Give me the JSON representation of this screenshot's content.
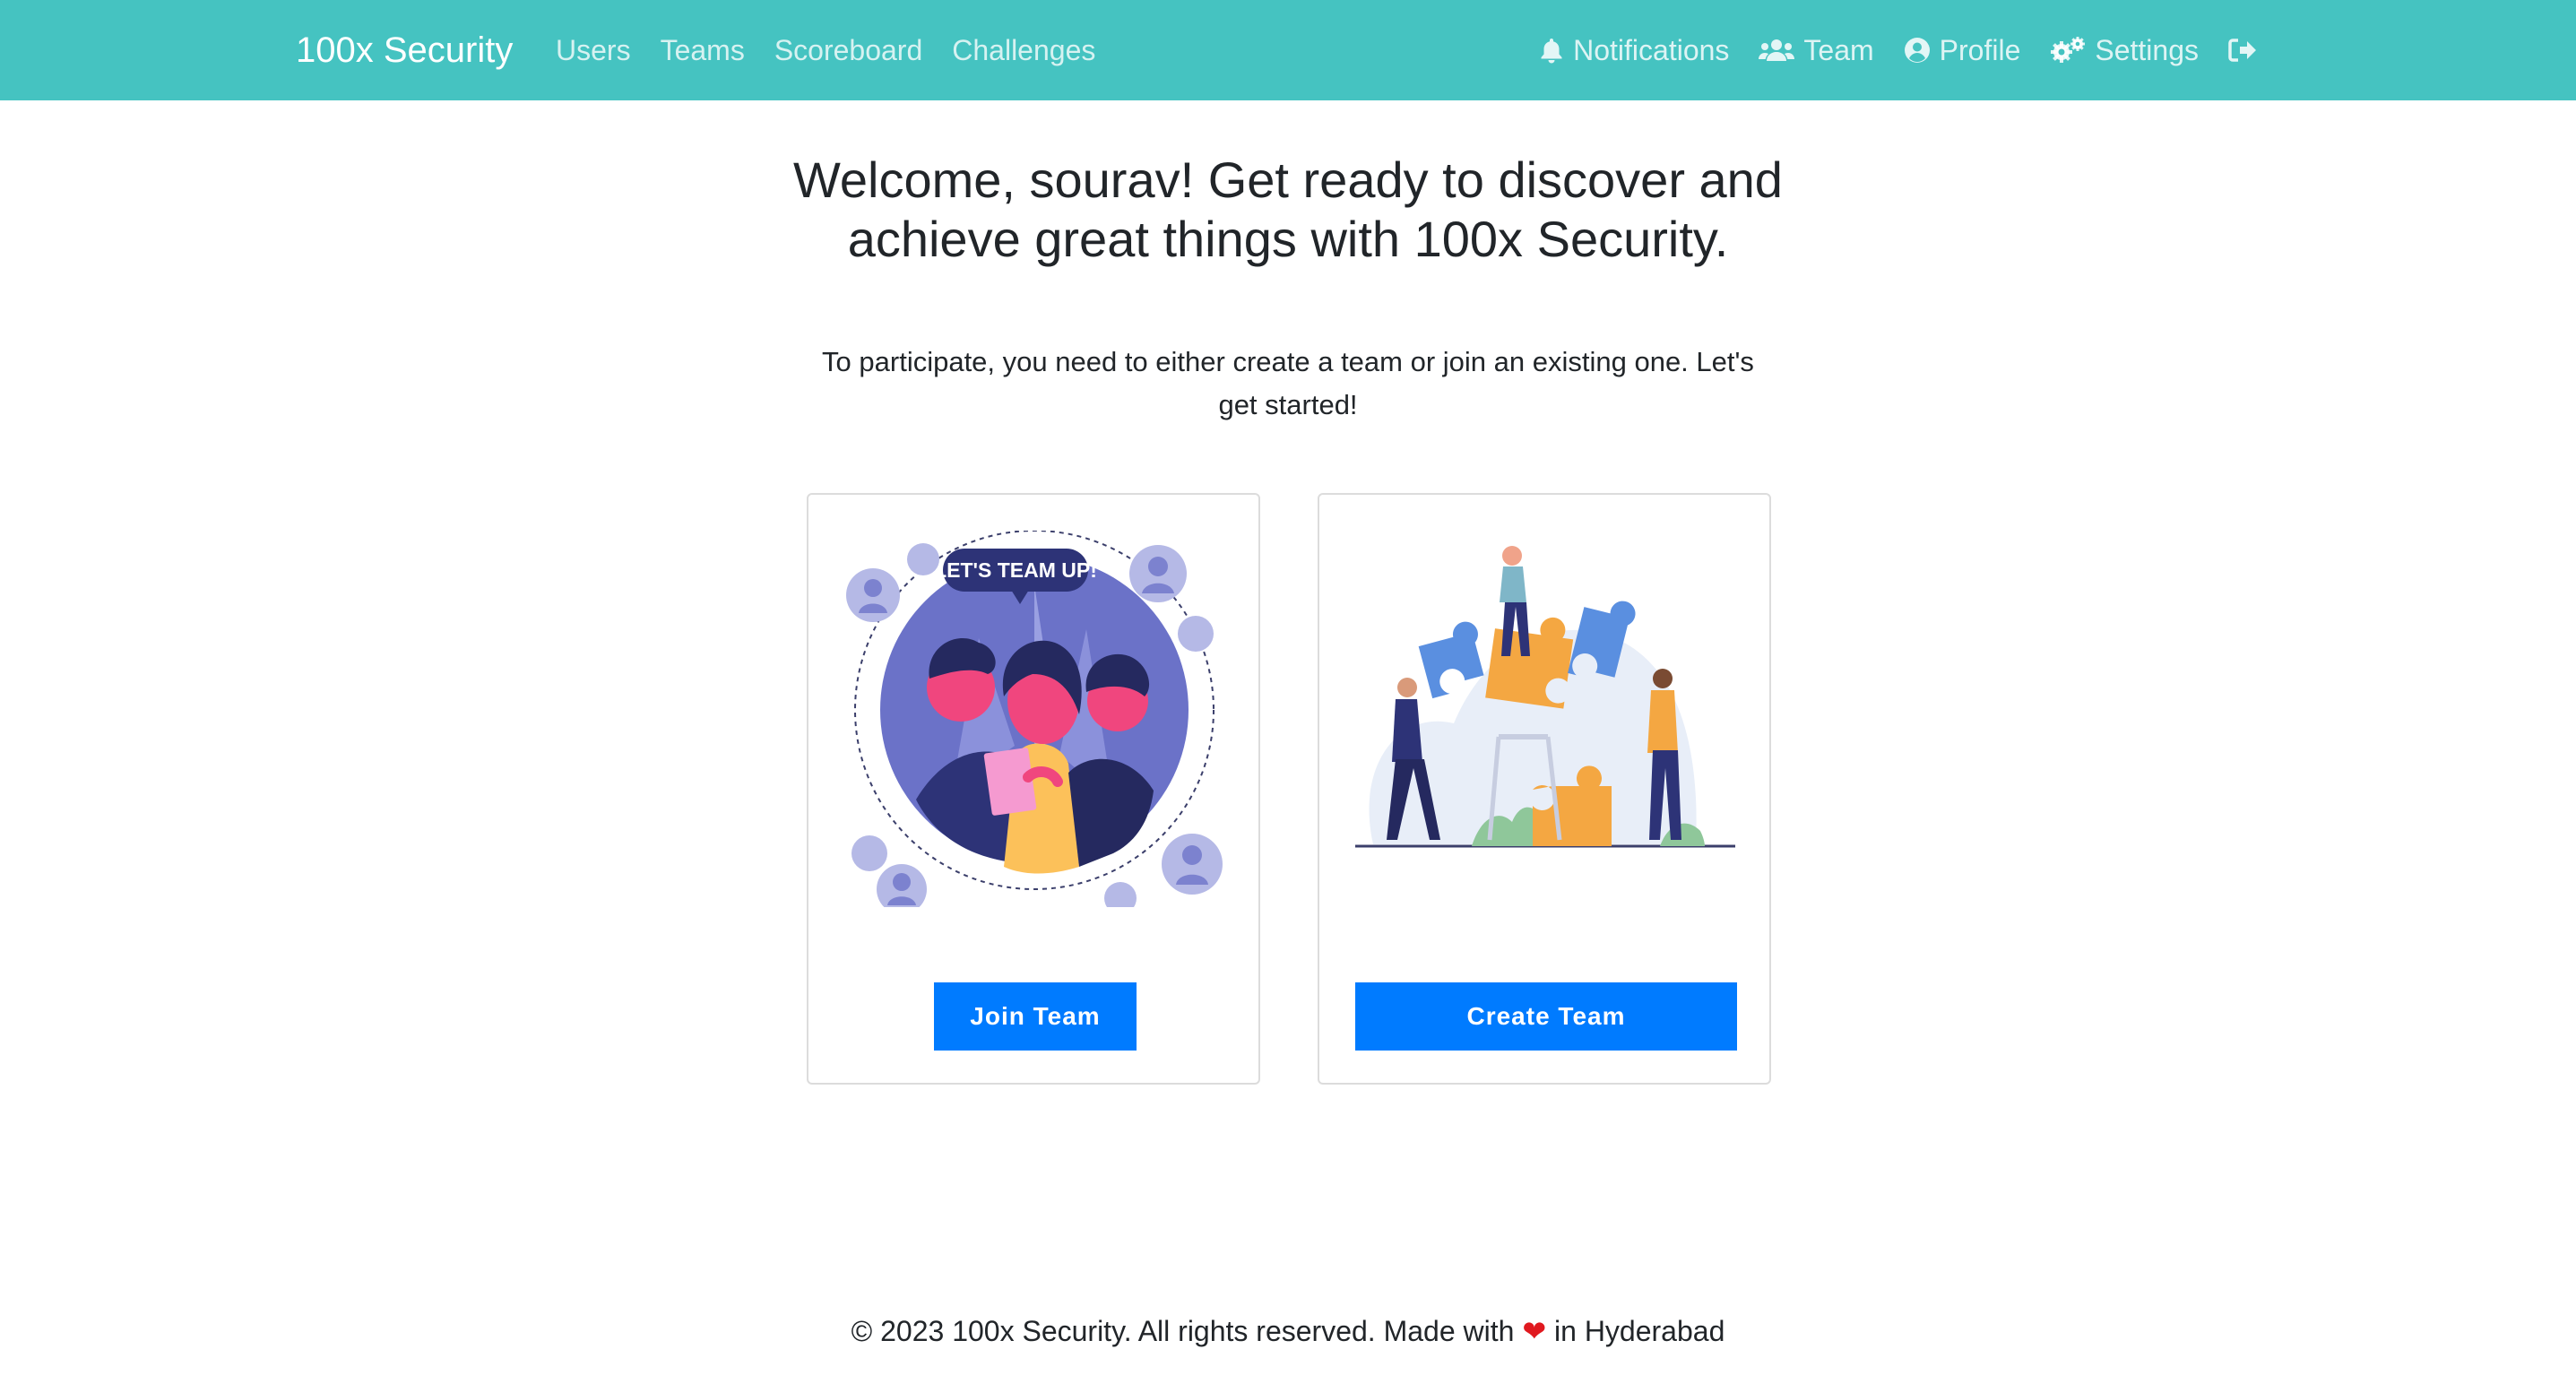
{
  "nav": {
    "brand": "100x Security",
    "left_links": [
      "Users",
      "Teams",
      "Scoreboard",
      "Challenges"
    ],
    "right_links": [
      {
        "label": "Notifications",
        "icon": "bell-icon"
      },
      {
        "label": "Team",
        "icon": "users-icon"
      },
      {
        "label": "Profile",
        "icon": "user-circle-icon"
      },
      {
        "label": "Settings",
        "icon": "gears-icon"
      },
      {
        "label": "",
        "icon": "logout-icon"
      }
    ]
  },
  "hero": {
    "title": "Welcome, sourav! Get ready to discover and achieve great things with 100x Security.",
    "subtitle": "To participate, you need to either create a team or join an existing one. Let's get started!"
  },
  "cards": {
    "join": {
      "illustration_text": "LET'S TEAM UP!",
      "button": "Join Team"
    },
    "create": {
      "button": "Create Team"
    }
  },
  "footer": {
    "before": "© 2023 100x Security. All rights reserved. Made with",
    "heart": "❤",
    "after": "in Hyderabad"
  },
  "colors": {
    "navbar": "#45c3c1",
    "primary": "#007bff",
    "heart": "#e0191f"
  }
}
